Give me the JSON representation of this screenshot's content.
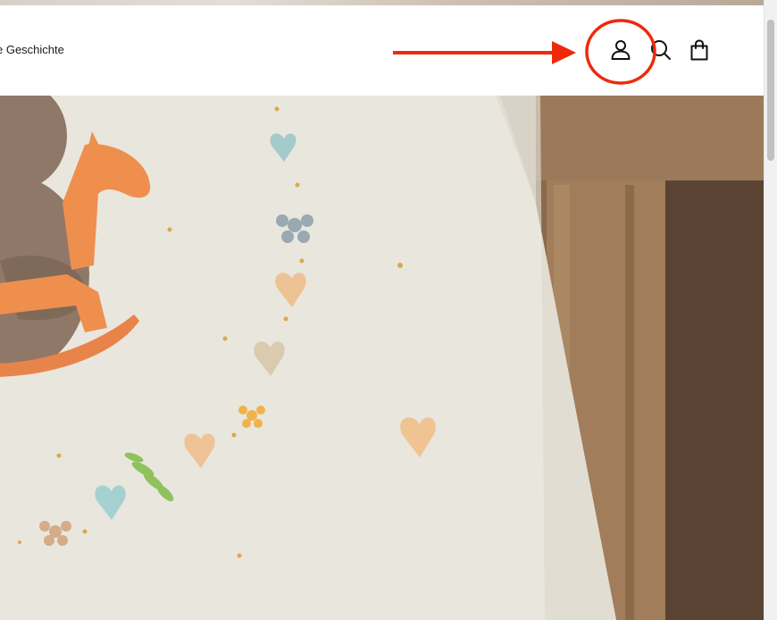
{
  "header": {
    "nav_label": "e Geschichte",
    "icons": [
      "account-icon",
      "search-icon",
      "cart-icon"
    ]
  },
  "annotation": {
    "color": "#ee2a0b",
    "arrow": "right-arrow",
    "highlight": "circle"
  },
  "hero": {
    "content": "illustrated-baby-card-photo"
  }
}
